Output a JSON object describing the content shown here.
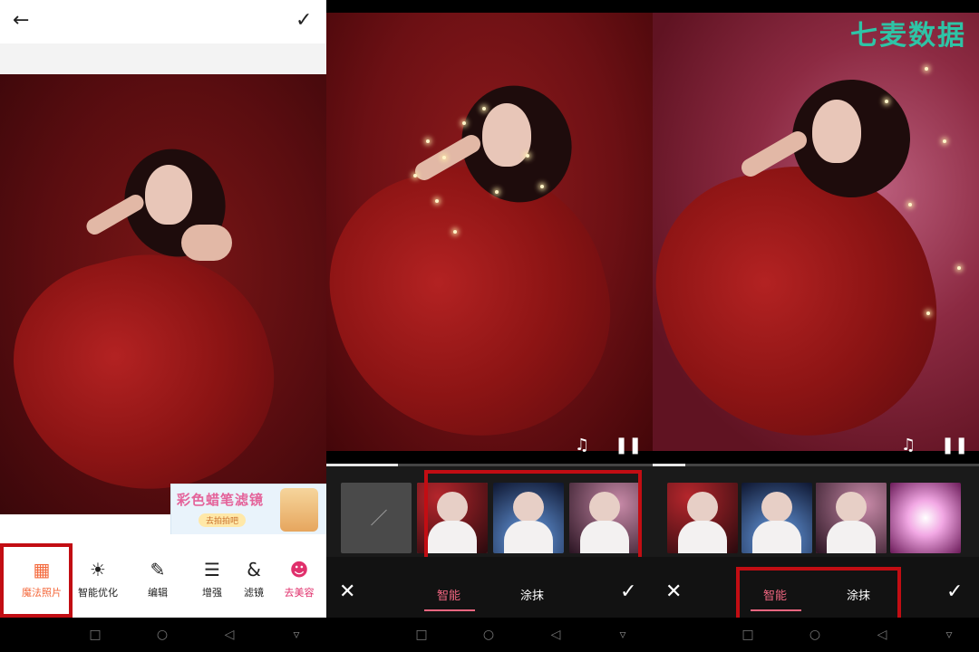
{
  "panel1": {
    "header": {
      "back_icon": "arrow-left-icon",
      "confirm_icon": "check-icon"
    },
    "ad": {
      "title": "彩色蜡笔滤镜",
      "subtitle": "去拍拍吧"
    },
    "tools": [
      {
        "label": "魔法照片",
        "icon": "magic-photo-icon",
        "glyph": "▦"
      },
      {
        "label": "智能优化",
        "icon": "lightbulb-icon",
        "glyph": "☀"
      },
      {
        "label": "编辑",
        "icon": "edit-icon",
        "glyph": "✎"
      },
      {
        "label": "增强",
        "icon": "sliders-icon",
        "glyph": "☰"
      },
      {
        "label": "滤镜",
        "icon": "filter-icon",
        "glyph": "&"
      },
      {
        "label": "去美容",
        "icon": "beauty-icon",
        "glyph": "☻"
      }
    ],
    "selected_tool": "魔法照片",
    "accent": "#f46a3d"
  },
  "panel2": {
    "controls": {
      "music_icon": "music-note-icon",
      "pause_icon": "pause-icon"
    },
    "progress": 0.22,
    "tabs": {
      "smart": "智能",
      "paint": "涂抹"
    },
    "active_tab": "智能",
    "cancel_icon": "close-icon",
    "confirm_icon": "check-icon"
  },
  "panel3": {
    "watermark": "七麦数据",
    "controls": {
      "music_icon": "music-note-icon",
      "pause_icon": "pause-icon"
    },
    "progress": 0.1,
    "tabs": {
      "smart": "智能",
      "paint": "涂抹"
    },
    "active_tab": "智能",
    "cancel_icon": "close-icon",
    "confirm_icon": "check-icon"
  },
  "colors": {
    "highlight_box": "#c20d13",
    "tab_active": "#f06680",
    "watermark": "#2ec4a6"
  }
}
